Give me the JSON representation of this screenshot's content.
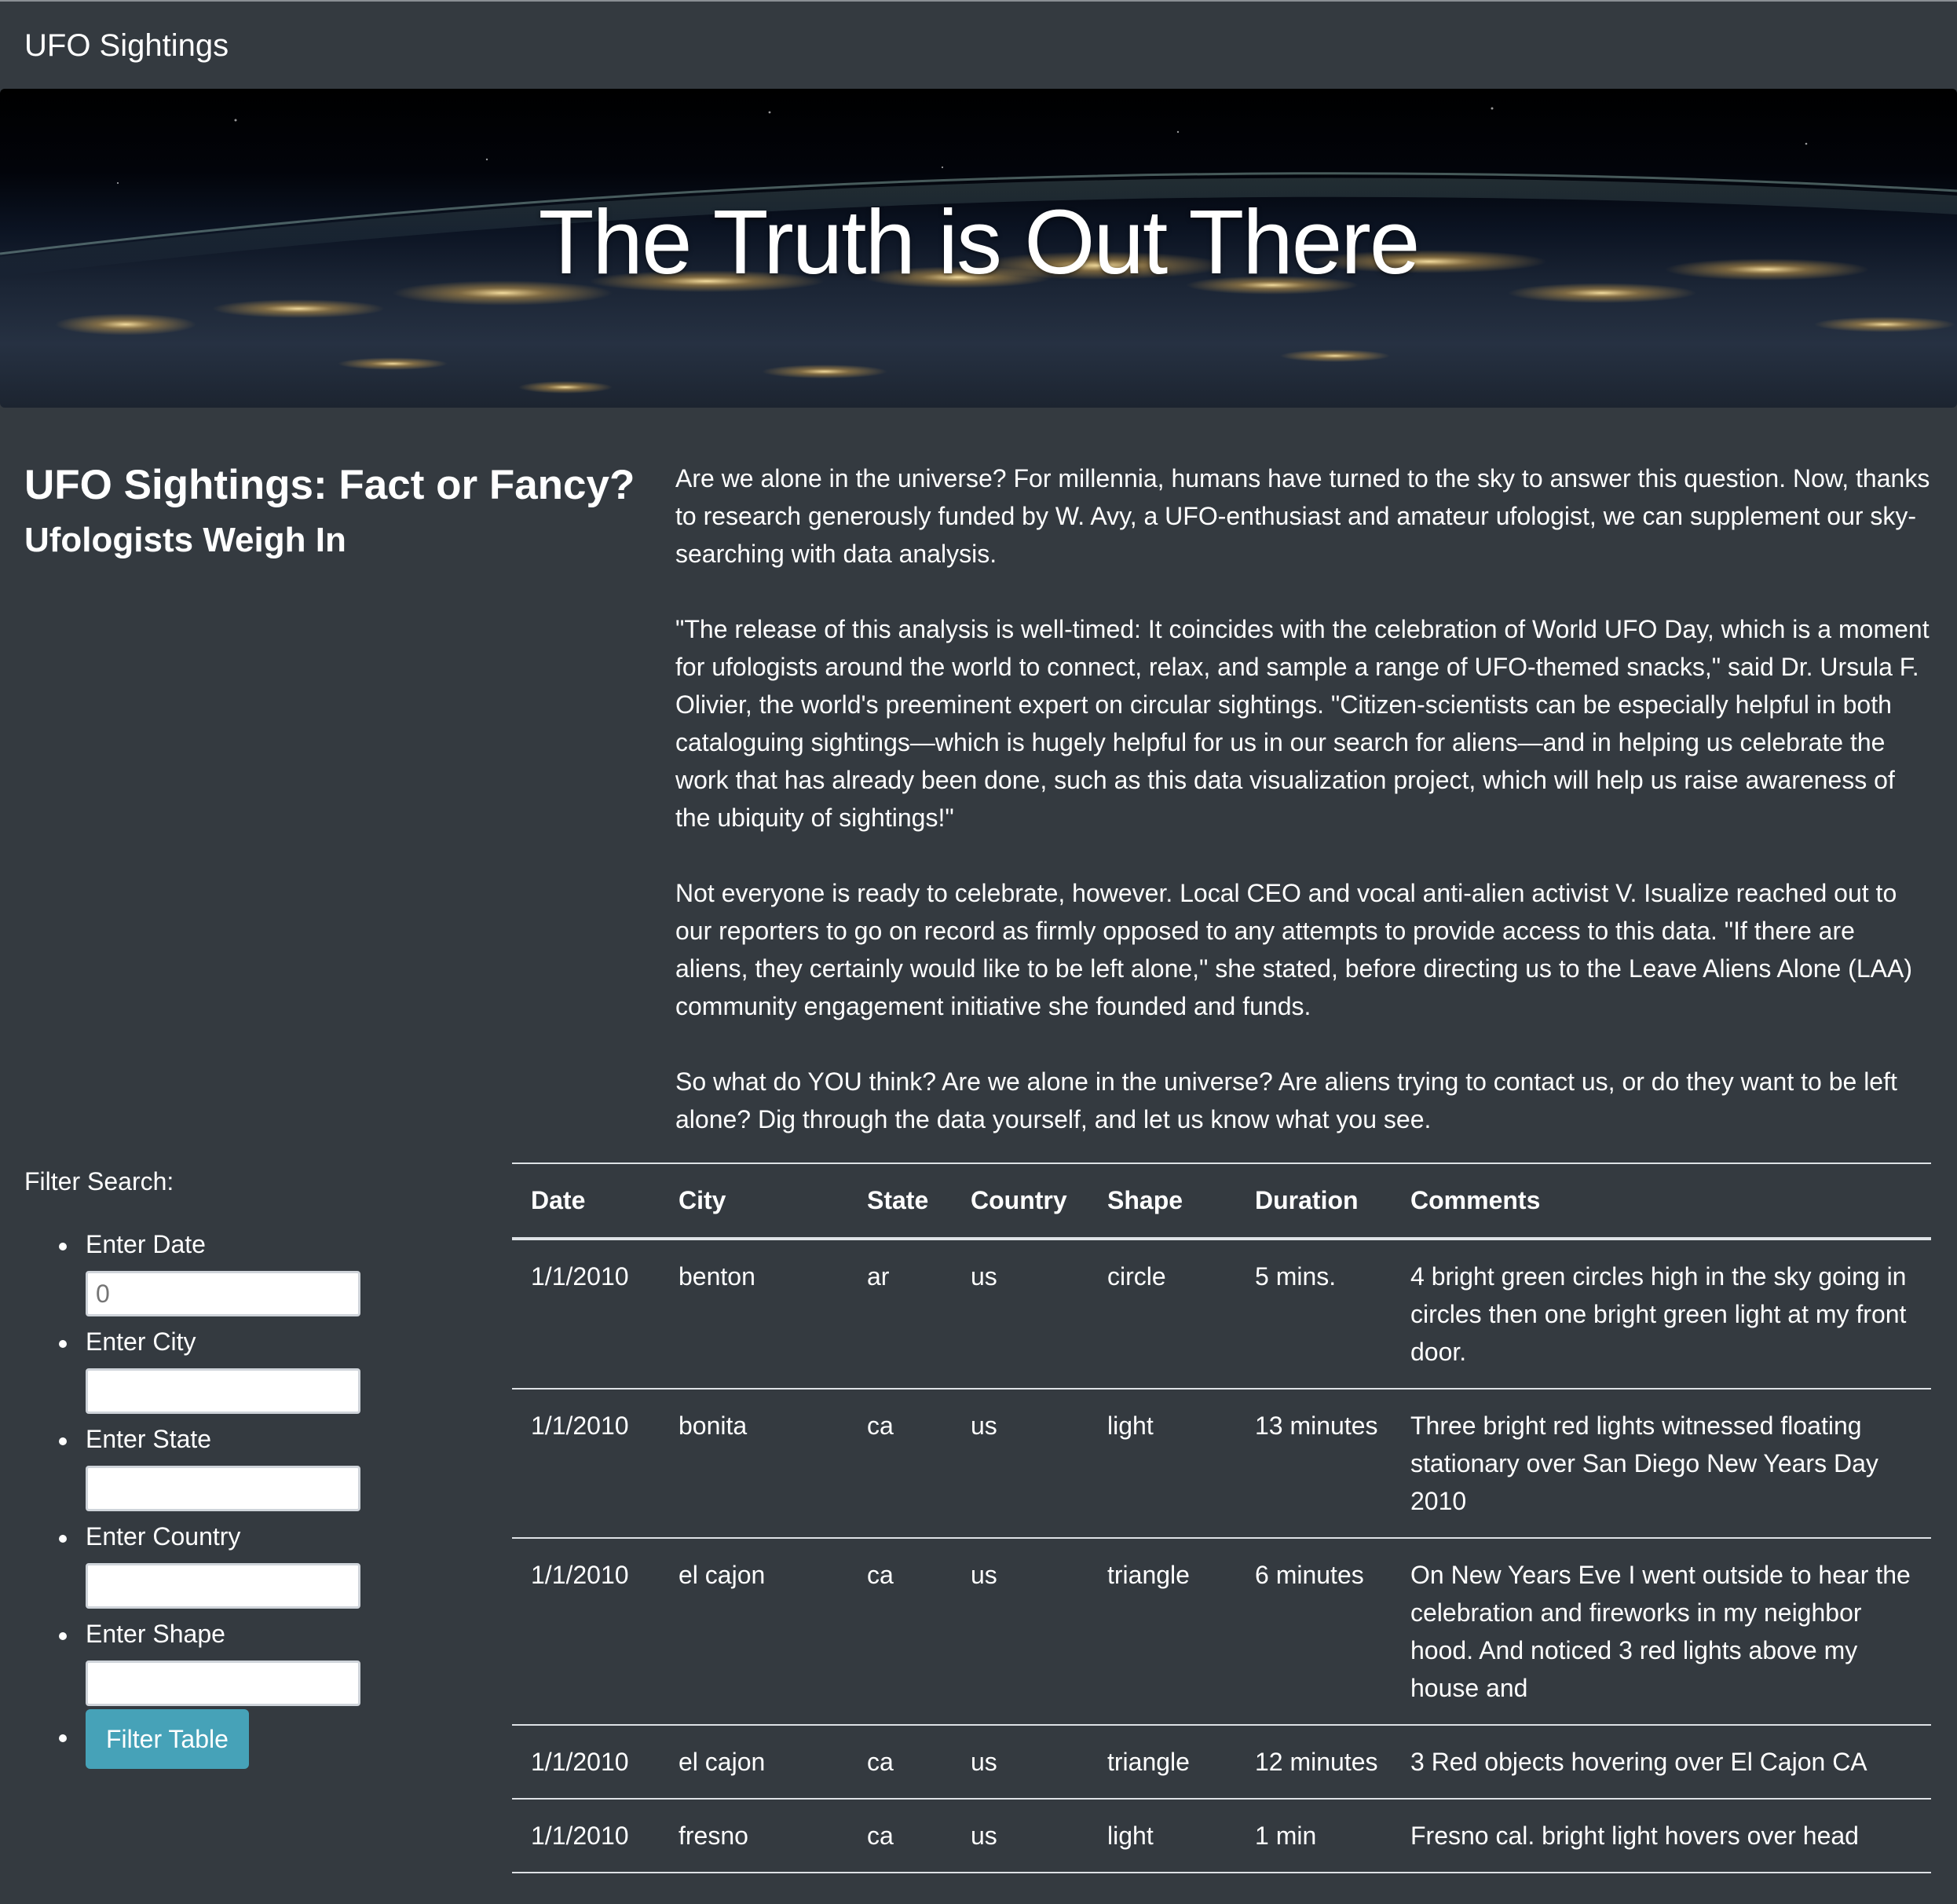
{
  "navbar": {
    "brand": "UFO Sightings"
  },
  "hero": {
    "title": "The Truth is Out There"
  },
  "article": {
    "title": "UFO Sightings: Fact or Fancy?",
    "subtitle": "Ufologists Weigh In",
    "paragraphs": [
      "Are we alone in the universe? For millennia, humans have turned to the sky to answer this question. Now, thanks to research generously funded by W. Avy, a UFO-enthusiast and amateur ufologist, we can supplement our sky-searching with data analysis.",
      "\"The release of this analysis is well-timed: It coincides with the celebration of World UFO Day, which is a moment for ufologists around the world to connect, relax, and sample a range of UFO-themed snacks,\" said Dr. Ursula F. Olivier, the world's preeminent expert on circular sightings. \"Citizen-scientists can be especially helpful in both cataloguing sightings—which is hugely helpful for us in our search for aliens—and in helping us celebrate the work that has already been done, such as this data visualization project, which will help us raise awareness of the ubiquity of sightings!\"",
      "Not everyone is ready to celebrate, however. Local CEO and vocal anti-alien activist V. Isualize reached out to our reporters to go on record as firmly opposed to any attempts to provide access to this data. \"If there are aliens, they certainly would like to be left alone,\" she stated, before directing us to the Leave Aliens Alone (LAA) community engagement initiative she founded and funds.",
      "So what do YOU think? Are we alone in the universe? Are aliens trying to contact us, or do they want to be left alone? Dig through the data yourself, and let us know what you see."
    ]
  },
  "filters": {
    "label": "Filter Search:",
    "date": {
      "label": "Enter Date",
      "value": "",
      "placeholder": "0"
    },
    "city": {
      "label": "Enter City",
      "value": "",
      "placeholder": ""
    },
    "state": {
      "label": "Enter State",
      "value": "",
      "placeholder": ""
    },
    "country": {
      "label": "Enter Country",
      "value": "",
      "placeholder": ""
    },
    "shape": {
      "label": "Enter Shape",
      "value": "",
      "placeholder": ""
    },
    "button_label": "Filter Table"
  },
  "table": {
    "headers": [
      "Date",
      "City",
      "State",
      "Country",
      "Shape",
      "Duration",
      "Comments"
    ],
    "rows": [
      [
        "1/1/2010",
        "benton",
        "ar",
        "us",
        "circle",
        "5 mins.",
        "4 bright green circles high in the sky going in circles then one bright green light at my front door."
      ],
      [
        "1/1/2010",
        "bonita",
        "ca",
        "us",
        "light",
        "13 minutes",
        "Three bright red lights witnessed floating stationary over San Diego New Years Day 2010"
      ],
      [
        "1/1/2010",
        "el cajon",
        "ca",
        "us",
        "triangle",
        "6 minutes",
        "On New Years Eve I went outside to hear the celebration and fireworks in my neighbor hood. And noticed 3 red lights above my house and"
      ],
      [
        "1/1/2010",
        "el cajon",
        "ca",
        "us",
        "triangle",
        "12 minutes",
        "3 Red objects hovering over El Cajon CA"
      ],
      [
        "1/1/2010",
        "fresno",
        "ca",
        "us",
        "light",
        "1 min",
        "Fresno cal. bright light hovers over head"
      ]
    ]
  },
  "colors": {
    "background": "#343a40",
    "button": "#46a2b8",
    "text": "#ffffff",
    "rule": "#dee2e6"
  }
}
